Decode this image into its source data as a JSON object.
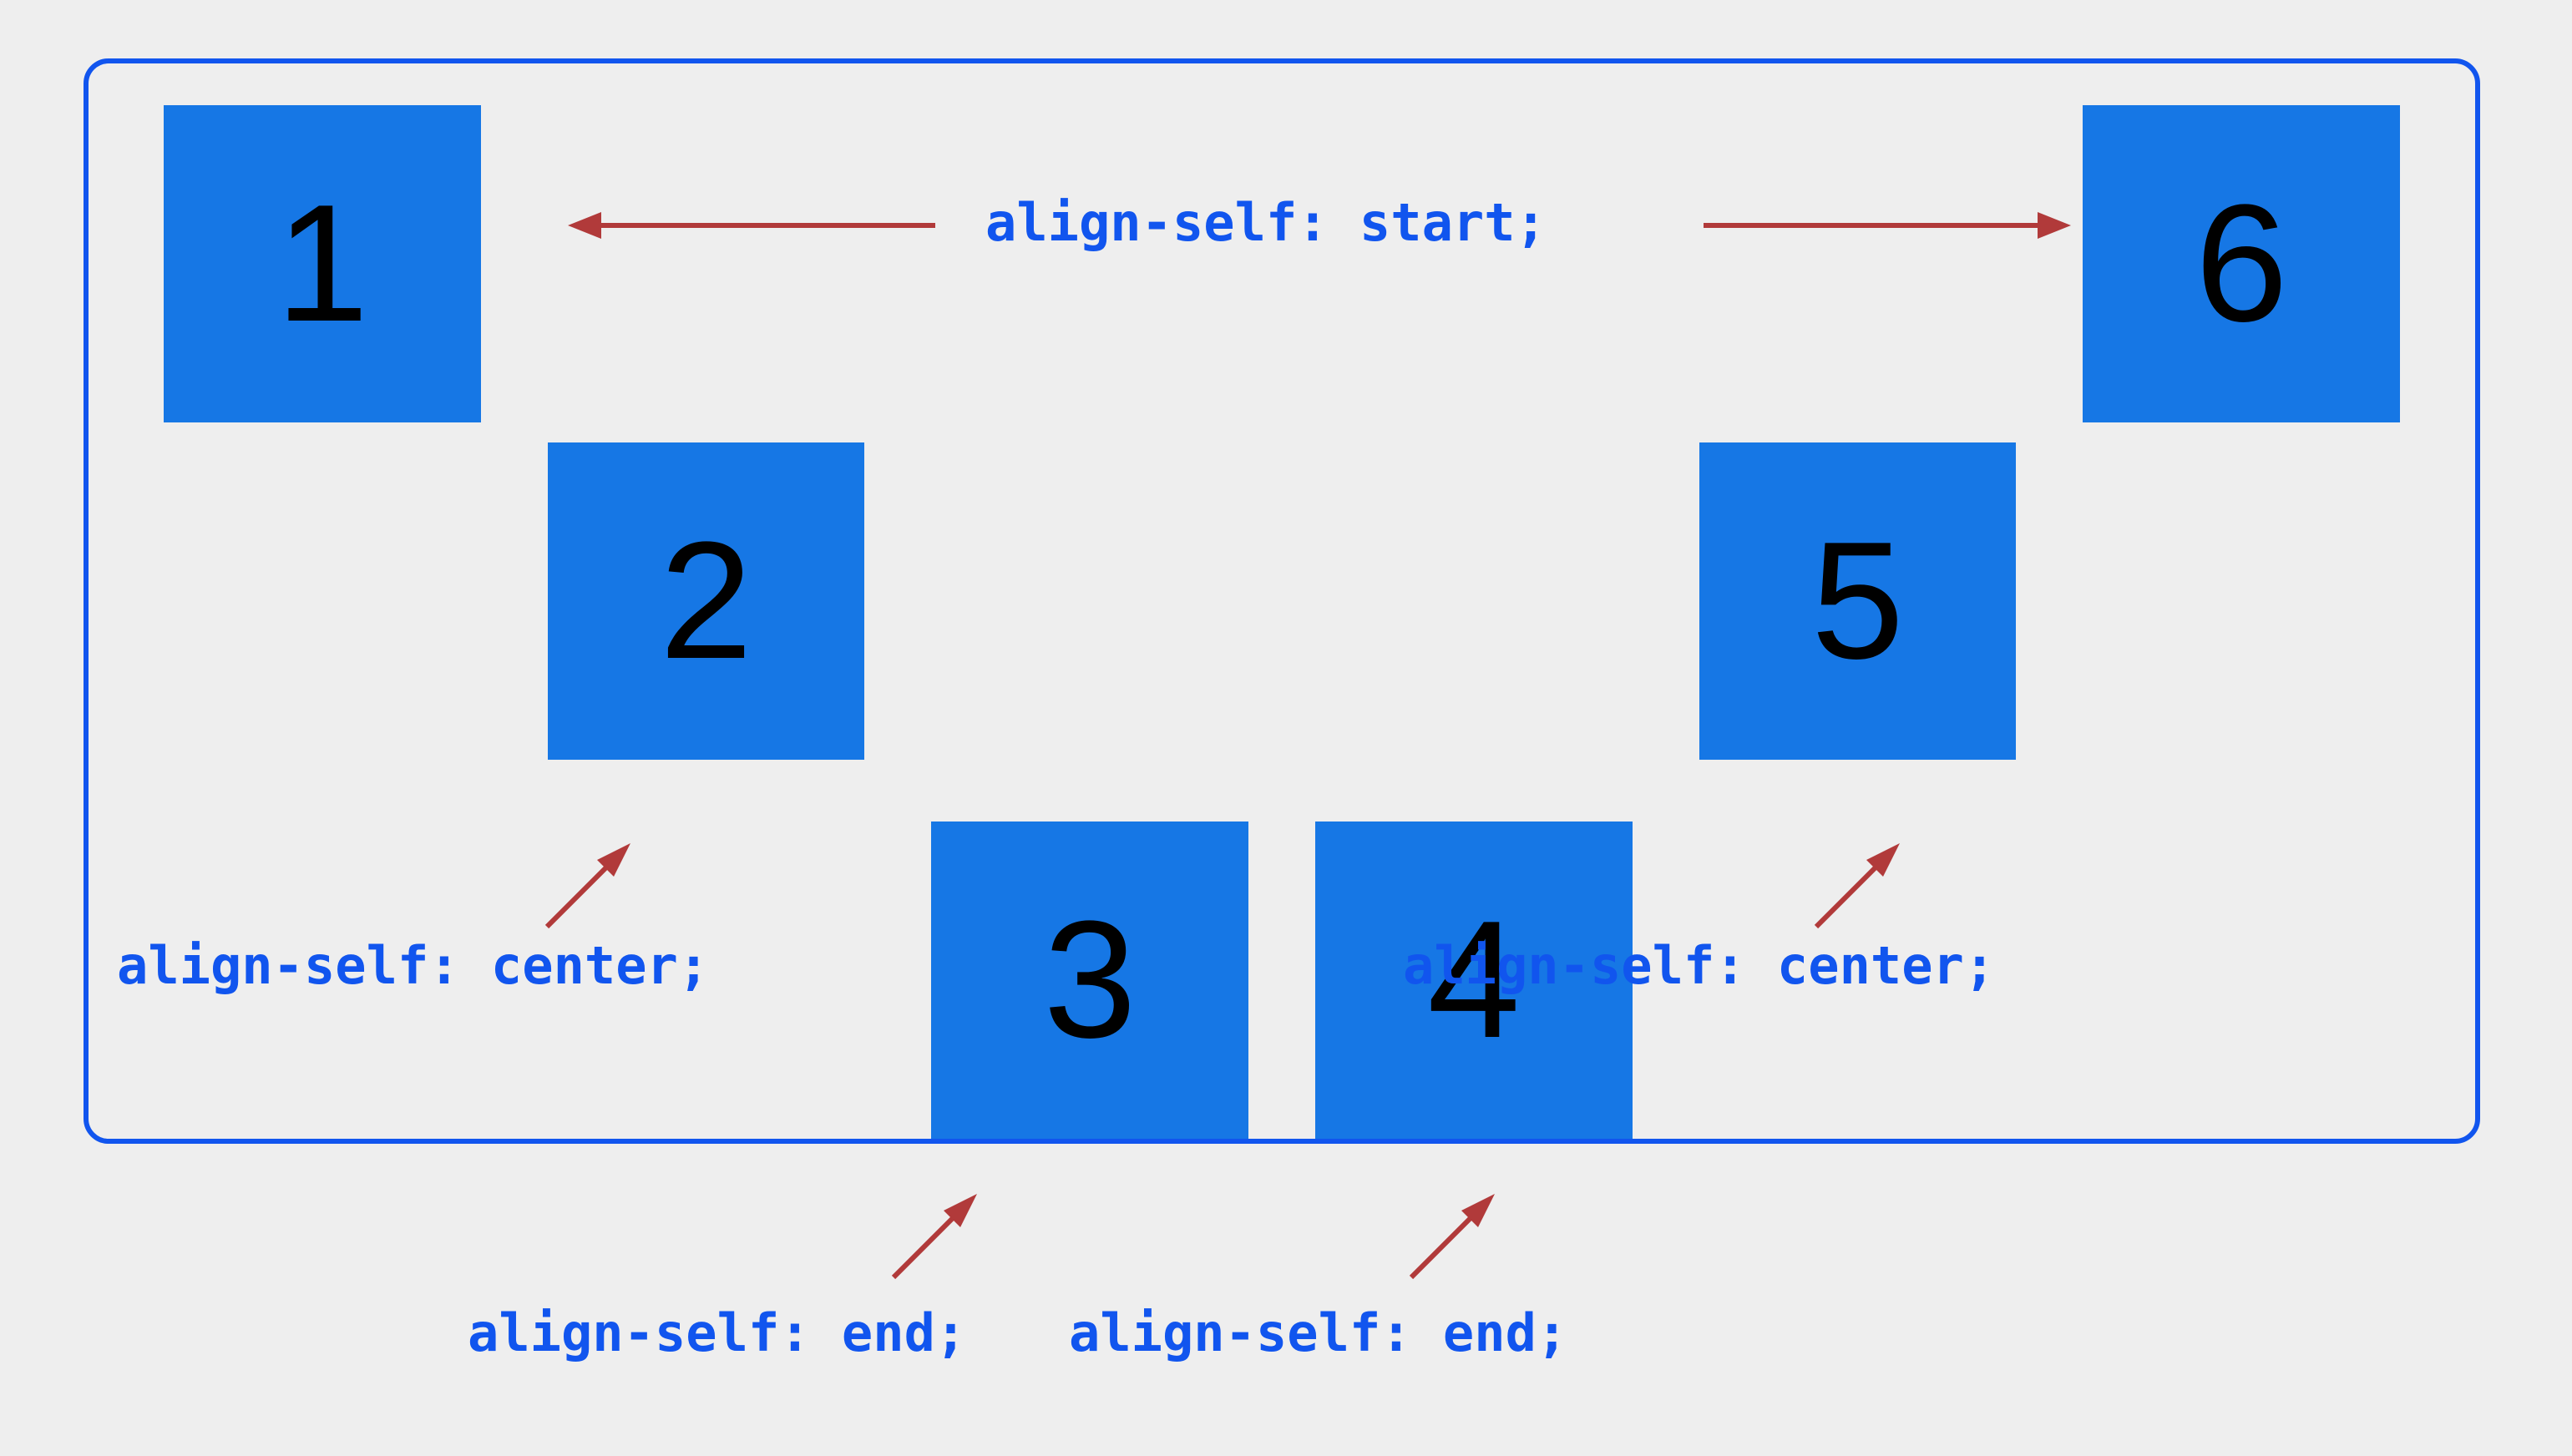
{
  "boxes": {
    "b1": "1",
    "b2": "2",
    "b3": "3",
    "b4": "4",
    "b5": "5",
    "b6": "6"
  },
  "labels": {
    "top": "align-self: start;",
    "left_c": "align-self: center;",
    "right_c": "align-self: center;",
    "left_e": "align-self: end;",
    "right_e": "align-self: end;"
  },
  "colors": {
    "box": "#1677e5",
    "border": "#1155ee",
    "label": "#1155ee",
    "arrow": "#b13a3a",
    "bg": "#eeeeee"
  },
  "chart_data": {
    "type": "table",
    "description": "CSS flexbox align-self diagram with 6 items",
    "items": [
      {
        "index": 1,
        "align_self": "start"
      },
      {
        "index": 2,
        "align_self": "center"
      },
      {
        "index": 3,
        "align_self": "end"
      },
      {
        "index": 4,
        "align_self": "end"
      },
      {
        "index": 5,
        "align_self": "center"
      },
      {
        "index": 6,
        "align_self": "start"
      }
    ]
  }
}
